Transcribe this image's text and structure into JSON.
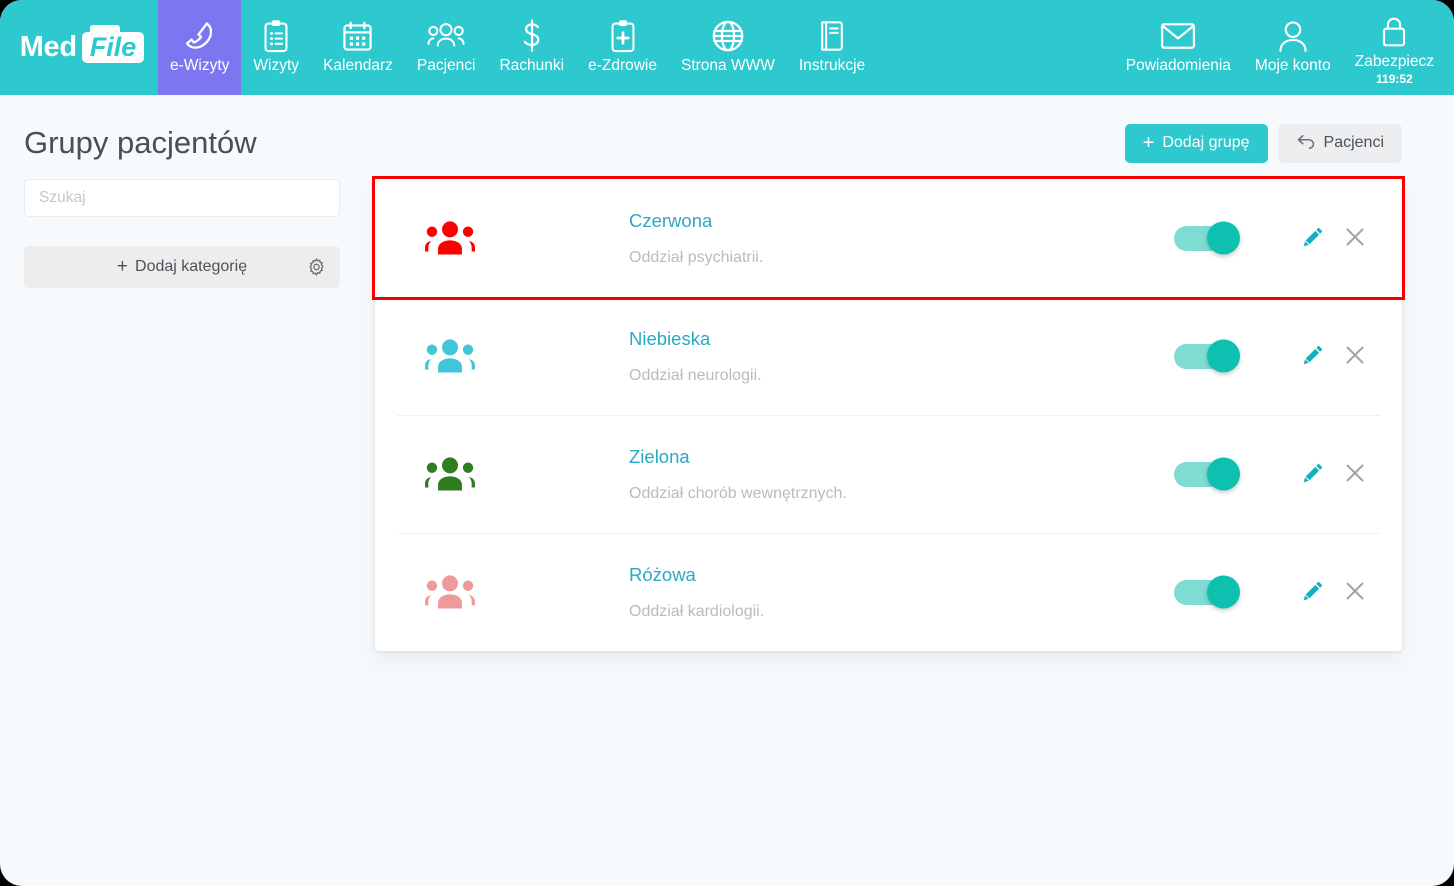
{
  "brand": {
    "part1": "Med",
    "part2": "File"
  },
  "topnav": {
    "left_items": [
      {
        "label": "e-Wizyty",
        "icon": "phone-icon",
        "active": true
      },
      {
        "label": "Wizyty",
        "icon": "clipboard-list-icon",
        "active": false
      },
      {
        "label": "Kalendarz",
        "icon": "calendar-icon",
        "active": false
      },
      {
        "label": "Pacjenci",
        "icon": "users-icon",
        "active": false
      },
      {
        "label": "Rachunki",
        "icon": "dollar-icon",
        "active": false
      },
      {
        "label": "e-Zdrowie",
        "icon": "clipboard-medical-icon",
        "active": false
      },
      {
        "label": "Strona WWW",
        "icon": "globe-icon",
        "active": false
      },
      {
        "label": "Instrukcje",
        "icon": "book-icon",
        "active": false
      }
    ],
    "right_items": [
      {
        "label": "Powiadomienia",
        "icon": "envelope-icon",
        "timer": ""
      },
      {
        "label": "Moje konto",
        "icon": "user-icon",
        "timer": ""
      },
      {
        "label": "Zabezpiecz",
        "icon": "lock-icon",
        "timer": "119:52"
      }
    ]
  },
  "header": {
    "title": "Grupy pacjentów",
    "add_group_label": "Dodaj grupę",
    "add_group_plus": "+",
    "back_label": "Pacjenci"
  },
  "sidebar": {
    "search_placeholder": "Szukaj",
    "search_value": "",
    "add_category_label": "Dodaj kategorię",
    "add_category_plus": "+"
  },
  "groups": [
    {
      "name": "Czerwona",
      "description": "Oddział psychiatrii.",
      "color": "#fc0000",
      "enabled": true,
      "highlighted": true
    },
    {
      "name": "Niebieska",
      "description": "Oddział neurologii.",
      "color": "#3fc6d8",
      "enabled": true,
      "highlighted": false
    },
    {
      "name": "Zielona",
      "description": "Oddział chorób wewnętrznych.",
      "color": "#2f7d20",
      "enabled": true,
      "highlighted": false
    },
    {
      "name": "Różowa",
      "description": "Oddział kardiologii.",
      "color": "#ef9a9a",
      "enabled": true,
      "highlighted": false
    }
  ],
  "colors": {
    "brand_teal": "#2ec8cf",
    "active_nav": "#7c77f0",
    "link_teal": "#2aa9c4",
    "toggle_on": "#0dc0b0",
    "highlight_border": "#fc0000",
    "page_bg": "#f7fafc"
  },
  "row_actions": {
    "edit_label": "edit",
    "delete_label": "delete",
    "toggle_label": "toggle"
  }
}
